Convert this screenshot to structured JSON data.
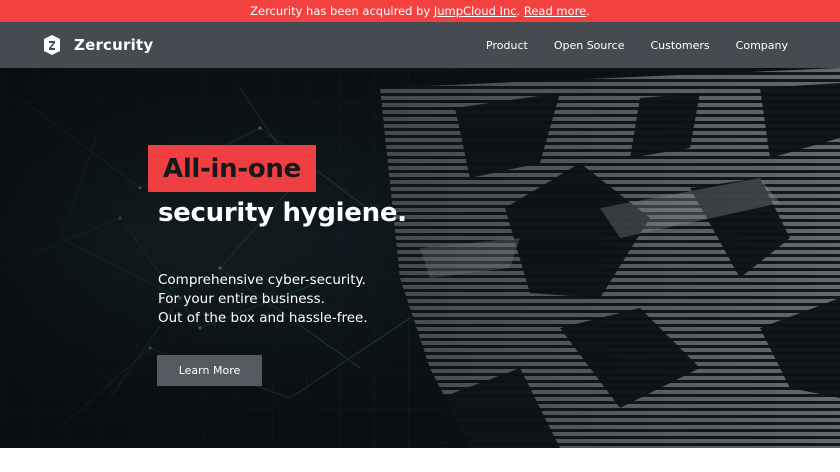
{
  "banner": {
    "prefix": "Zercurity has been acquired by ",
    "link_company": "JumpCloud Inc",
    "separator": ". ",
    "link_read_more": "Read more",
    "suffix": "."
  },
  "brand": {
    "name": "Zercurity",
    "logo_icon": "shield-logo-icon"
  },
  "nav": {
    "items": [
      {
        "label": "Product"
      },
      {
        "label": "Open Source"
      },
      {
        "label": "Customers"
      },
      {
        "label": "Company"
      }
    ]
  },
  "hero": {
    "headline_highlight": "All-in-one",
    "headline_rest": "security hygiene.",
    "tagline_lines": [
      "Comprehensive cyber-security.",
      "For your entire business.",
      "Out of the box and hassle-free."
    ],
    "cta_label": "Learn More"
  },
  "colors": {
    "banner_bg": "#f2413f",
    "nav_bg": "#464b52",
    "accent": "#ef3f43",
    "cta_bg": "#555a60",
    "hero_bg": "#0c1013"
  }
}
